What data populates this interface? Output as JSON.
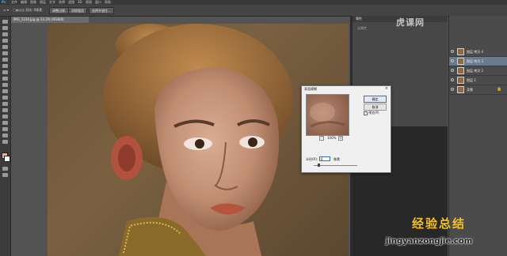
{
  "app": {
    "logo": "Ps"
  },
  "menu": [
    "文件",
    "编辑",
    "图像",
    "图层",
    "文字",
    "选择",
    "滤镜",
    "3D",
    "视图",
    "窗口",
    "帮助"
  ],
  "options_bar": {
    "pill_1": "调整边缘...",
    "pill_2": "消除锯齿",
    "pill_3": "选择并遮住...",
    "label_feather": "羽化: 0像素"
  },
  "document_tab": {
    "label": "IMG_1234.jpg @ 33.3% (RGB/8)"
  },
  "panels": {
    "properties_title": "属性",
    "properties_hint": "无属性"
  },
  "layers": [
    {
      "name": "图层 拷贝 4",
      "selected": false
    },
    {
      "name": "图层 拷贝 3",
      "selected": true
    },
    {
      "name": "图层 拷贝 2",
      "selected": false
    },
    {
      "name": "图层 1",
      "selected": false
    },
    {
      "name": "背景",
      "selected": false
    }
  ],
  "dialog": {
    "title": "表面模糊",
    "close": "×",
    "ok": "确定",
    "cancel": "取消",
    "preview": "预览(P)",
    "zoom_out": "-",
    "zoom_in": "+",
    "zoom_pct": "100%",
    "radius_label": "半径(R):",
    "radius_value": "6",
    "radius_unit": "像素"
  },
  "watermarks": {
    "brand": "虎课网",
    "site_cn": "经验总结",
    "site_url": "jingyanzongjie.com"
  },
  "colors": {
    "selection": "#6a7b8e",
    "ok_border": "#3a6fb5",
    "watermark_gold": "#f2c219"
  }
}
